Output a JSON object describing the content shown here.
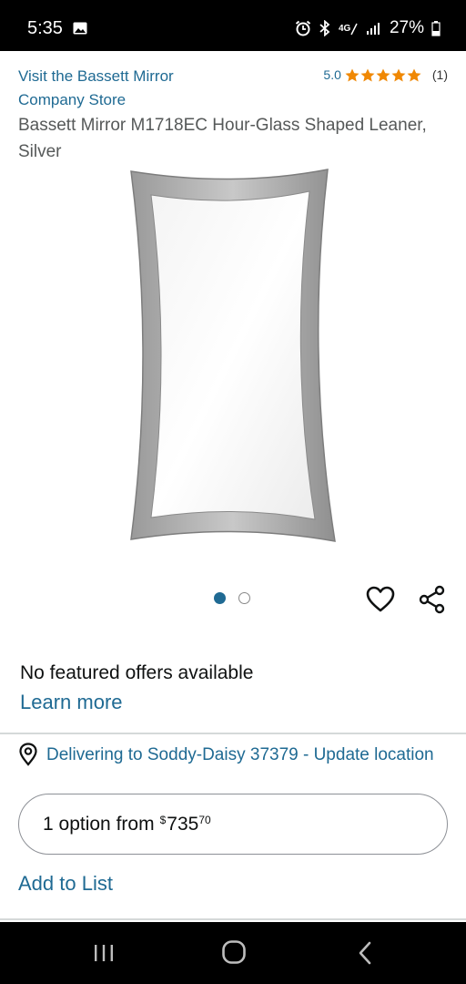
{
  "status_bar": {
    "time": "5:35",
    "network": "4G",
    "battery": "27%"
  },
  "product": {
    "store_link": "Visit the Bassett Mirror Company Store",
    "rating_score": "5.0",
    "rating_stars": 5,
    "rating_count": "(1)",
    "title": "Bassett Mirror M1718EC Hour-Glass Shaped Leaner, Silver",
    "image_count": 2,
    "current_image": 1
  },
  "offers": {
    "no_offers_text": "No featured offers available",
    "learn_more": "Learn more"
  },
  "delivery": {
    "text": "Delivering to Soddy-Daisy 37379 - Update location"
  },
  "options": {
    "label": "1 option from",
    "currency": "$",
    "price_whole": "735",
    "price_fraction": "70"
  },
  "add_to_list": "Add to List",
  "colors": {
    "link": "#1f6a93",
    "star": "#f08804",
    "text": "#0f1111",
    "secondary_text": "#565959"
  },
  "icons": {
    "wishlist": "heart-icon",
    "share": "share-icon",
    "location": "location-pin-icon",
    "nav_recents": "recents-icon",
    "nav_home": "home-icon",
    "nav_back": "back-icon"
  }
}
